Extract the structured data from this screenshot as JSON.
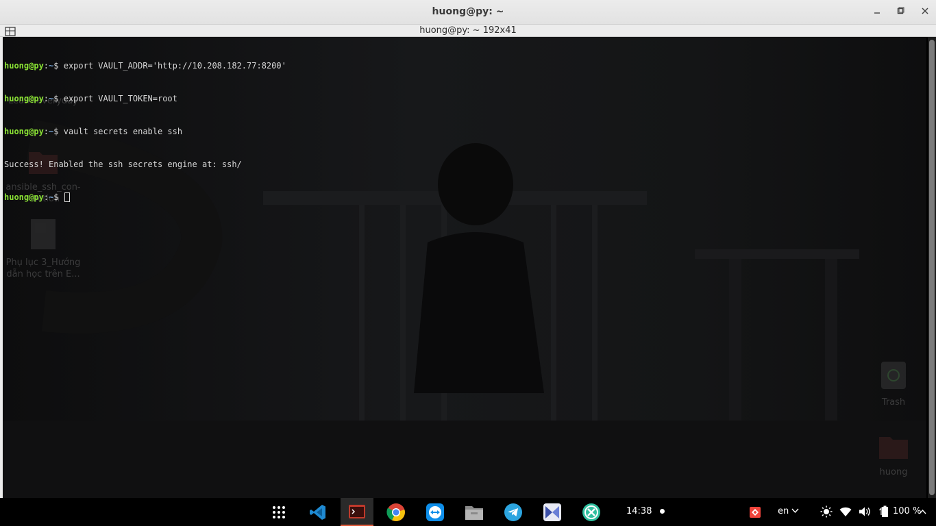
{
  "window": {
    "title": "huong@py: ~",
    "tab_title": "huong@py: ~ 192x41",
    "minimize_icon": "minimize-icon",
    "maximize_icon": "maximize-icon",
    "close_icon": "close-icon"
  },
  "terminal": {
    "lines": [
      {
        "user": "huong@py",
        "sep": ":",
        "path": "~",
        "prompt": "$ ",
        "cmd": "export VAULT_ADDR='http://10.208.182.77:8200'"
      },
      {
        "user": "huong@py",
        "sep": ":",
        "path": "~",
        "prompt": "$ ",
        "cmd": "export VAULT_TOKEN=root"
      },
      {
        "user": "huong@py",
        "sep": ":",
        "path": "~",
        "prompt": "$ ",
        "cmd": "vault secrets enable ssh"
      },
      {
        "output": "Success! Enabled the ssh secrets engine at: ssh/"
      },
      {
        "user": "huong@py",
        "sep": ":",
        "path": "~",
        "prompt": "$ ",
        "cmd": ""
      }
    ]
  },
  "desktop": {
    "icons": [
      {
        "label": "Learn-everyday"
      },
      {
        "label": "ansible_ssh_con-\nnection"
      },
      {
        "label": "Phụ lục 3_Hướng\ndẫn học trên E..."
      },
      {
        "label": "Trash"
      },
      {
        "label": "huong"
      }
    ]
  },
  "dock": {
    "apps": [
      "apps-grid-icon",
      "vscode-icon",
      "terminal-icon",
      "chrome-icon",
      "teamviewer-icon",
      "files-icon",
      "telegram-icon",
      "kolourpaint-icon",
      "xmind-icon"
    ],
    "clock": "14:38",
    "language": "en",
    "battery": "100 %",
    "colors": {
      "accent": "#e05a3a",
      "prompt_user": "#8ae234",
      "prompt_path": "#729fcf"
    }
  }
}
